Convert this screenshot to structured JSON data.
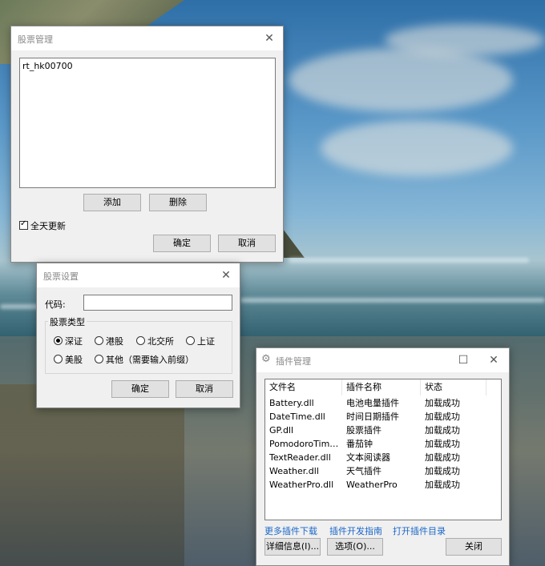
{
  "stock_mgmt": {
    "title": "股票管理",
    "close_icon": "✕",
    "list_items": [
      "rt_hk00700"
    ],
    "add_label": "添加",
    "delete_label": "删除",
    "all_day_label": "全天更新",
    "all_day_checked": true,
    "ok_label": "确定",
    "cancel_label": "取消"
  },
  "stock_settings": {
    "title": "股票设置",
    "close_icon": "✕",
    "code_label": "代码:",
    "code_value": "",
    "group_label": "股票类型",
    "types": [
      {
        "label": "深证",
        "selected": true
      },
      {
        "label": "港股",
        "selected": false
      },
      {
        "label": "北交所",
        "selected": false
      },
      {
        "label": "上证",
        "selected": false
      },
      {
        "label": "美股",
        "selected": false
      },
      {
        "label": "其他（需要输入前缀）",
        "selected": false
      }
    ],
    "ok_label": "确定",
    "cancel_label": "取消"
  },
  "plugin_mgmt": {
    "title": "插件管理",
    "gear_icon": "⚙",
    "maximize_icon": "☐",
    "close_icon": "✕",
    "columns": [
      "文件名",
      "插件名称",
      "状态"
    ],
    "rows": [
      {
        "file": "Battery.dll",
        "name": "电池电量插件",
        "status": "加载成功"
      },
      {
        "file": "DateTime.dll",
        "name": "时间日期插件",
        "status": "加载成功"
      },
      {
        "file": "GP.dll",
        "name": "股票插件",
        "status": "加载成功"
      },
      {
        "file": "PomodoroTimer....",
        "name": "番茄钟",
        "status": "加载成功"
      },
      {
        "file": "TextReader.dll",
        "name": "文本阅读器",
        "status": "加载成功"
      },
      {
        "file": "Weather.dll",
        "name": "天气插件",
        "status": "加载成功"
      },
      {
        "file": "WeatherPro.dll",
        "name": "WeatherPro",
        "status": "加载成功"
      }
    ],
    "links": [
      "更多插件下载",
      "插件开发指南",
      "打开插件目录"
    ],
    "details_label": "详细信息(I)...",
    "options_label": "选项(O)...",
    "close_label": "关闭"
  }
}
